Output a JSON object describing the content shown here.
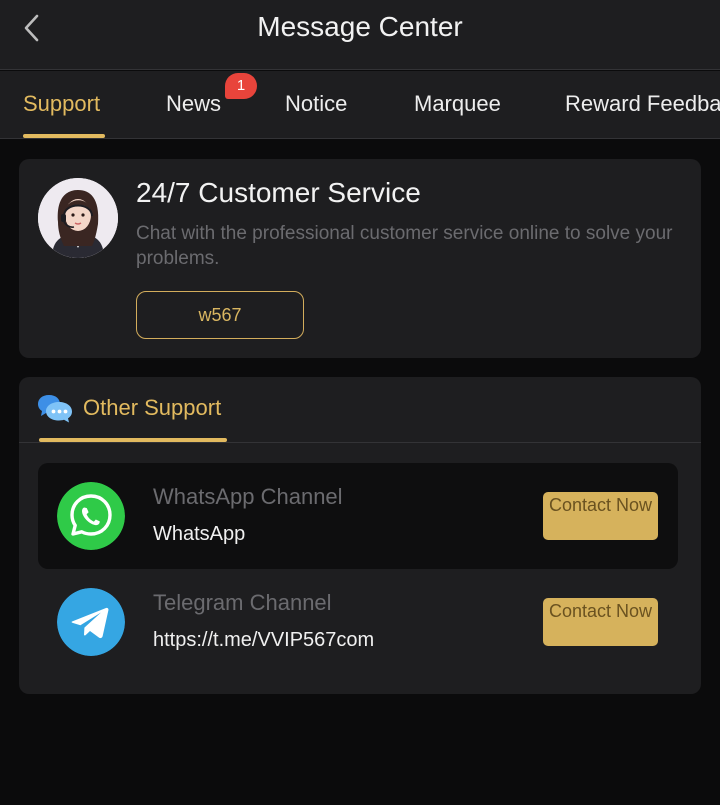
{
  "header": {
    "title": "Message Center",
    "back_icon": "chevron-left-icon"
  },
  "tabs": [
    {
      "label": "Support",
      "active": true
    },
    {
      "label": "News",
      "badge": "1"
    },
    {
      "label": "Notice"
    },
    {
      "label": "Marquee"
    },
    {
      "label": "Reward Feedback"
    }
  ],
  "service": {
    "title": "24/7 Customer Service",
    "description": "Chat with the professional customer service online to solve your problems.",
    "code": "w567",
    "avatar_icon": "support-agent-avatar"
  },
  "other_support": {
    "title": "Other Support",
    "icon": "chat-bubbles-icon",
    "channels": [
      {
        "name": "WhatsApp Channel",
        "value": "WhatsApp",
        "button": "Contact Now",
        "icon": "whatsapp-icon",
        "color": "#2fca48"
      },
      {
        "name": "Telegram Channel",
        "value": "https://t.me/VVIP567com",
        "button": "Contact Now",
        "icon": "telegram-icon",
        "color": "#35a6e3"
      }
    ]
  },
  "colors": {
    "accent": "#e2ba5f",
    "background": "#0b0b0c",
    "card": "#1e1e20",
    "badge": "#e8443b"
  }
}
